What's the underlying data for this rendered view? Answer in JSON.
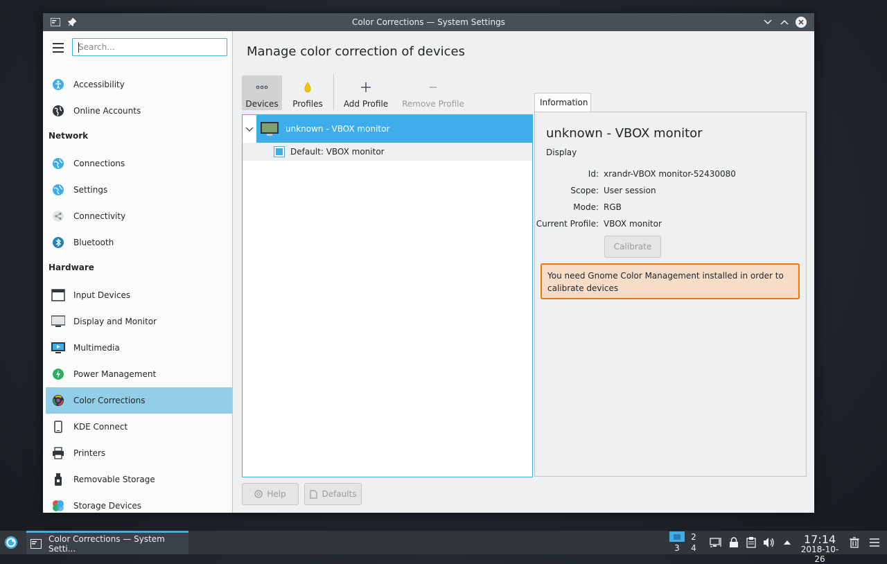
{
  "window": {
    "title": "Color Corrections — System Settings"
  },
  "search": {
    "placeholder": "Search..."
  },
  "sidebar": {
    "items": [
      {
        "label": "Accessibility"
      },
      {
        "label": "Online Accounts"
      },
      {
        "label": "Connections"
      },
      {
        "label": "Settings"
      },
      {
        "label": "Connectivity"
      },
      {
        "label": "Bluetooth"
      },
      {
        "label": "Input Devices"
      },
      {
        "label": "Display and Monitor"
      },
      {
        "label": "Multimedia"
      },
      {
        "label": "Power Management"
      },
      {
        "label": "Color Corrections"
      },
      {
        "label": "KDE Connect"
      },
      {
        "label": "Printers"
      },
      {
        "label": "Removable Storage"
      },
      {
        "label": "Storage Devices"
      }
    ],
    "sections": {
      "network": "Network",
      "hardware": "Hardware"
    }
  },
  "main": {
    "title": "Manage color correction of devices",
    "toolbar": {
      "devices": "Devices",
      "profiles": "Profiles",
      "add_profile": "Add Profile",
      "remove_profile": "Remove Profile"
    },
    "tree": {
      "device": "unknown - VBOX monitor",
      "profile": "Default: VBOX monitor"
    },
    "info": {
      "tab": "Information",
      "name": "unknown - VBOX monitor",
      "kind": "Display",
      "id_label": "Id:",
      "id_value": "xrandr-VBOX monitor-52430080",
      "scope_label": "Scope:",
      "scope_value": "User session",
      "mode_label": "Mode:",
      "mode_value": "RGB",
      "profile_label": "Current Profile:",
      "profile_value": "VBOX monitor",
      "calibrate": "Calibrate",
      "warning": "You need Gnome Color Management installed in order to calibrate devices"
    },
    "help": "Help",
    "defaults": "Defaults"
  },
  "taskbar": {
    "task_label": "Color Corrections  — System Setti...",
    "pager": [
      "1",
      "2",
      "3",
      "4"
    ],
    "time": "17:14",
    "date": "2018-10-26"
  },
  "colors": {
    "accent": "#3daee9",
    "selected_sidebar": "#93cee9",
    "warning_border": "#f67400",
    "warning_bg": "#f7ddc8",
    "titlebar": "#475057",
    "panel": "#31363b"
  }
}
